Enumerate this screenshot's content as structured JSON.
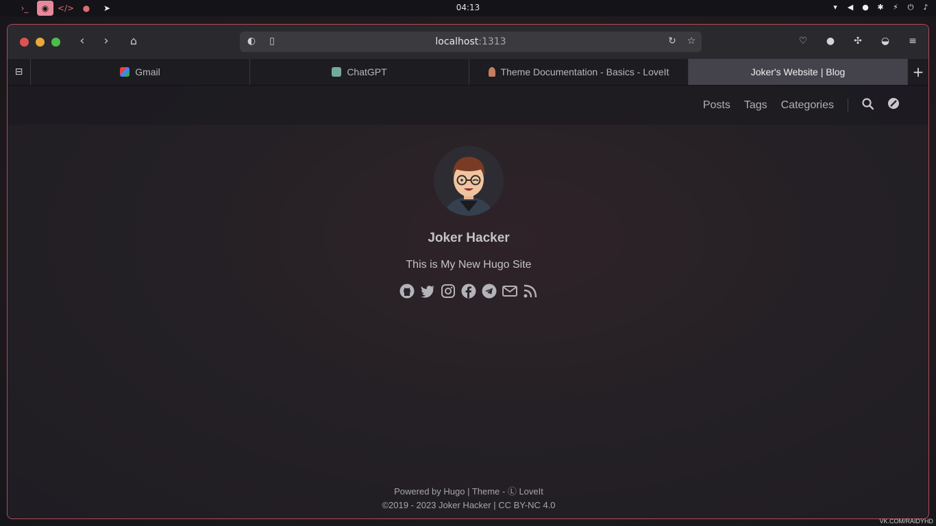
{
  "system_bar": {
    "clock": "04:13",
    "apps": [
      {
        "name": "terminal-icon",
        "glyph": "›_"
      },
      {
        "name": "browser-icon",
        "glyph": "◉"
      },
      {
        "name": "code-icon",
        "glyph": "</>"
      },
      {
        "name": "chat-icon",
        "glyph": "●"
      },
      {
        "name": "telegram-icon",
        "glyph": "➤"
      }
    ]
  },
  "browser": {
    "url_host": "localhost",
    "url_port": ":1313",
    "tabs": [
      {
        "label": "Gmail",
        "favicon": "gmail"
      },
      {
        "label": "ChatGPT",
        "favicon": "chatgpt"
      },
      {
        "label": "Theme Documentation - Basics - LoveIt",
        "favicon": "joker"
      },
      {
        "label": "Joker's Website | Blog",
        "favicon": "none"
      }
    ],
    "add_tab_label": "+"
  },
  "site": {
    "menu": {
      "posts": "Posts",
      "tags": "Tags",
      "categories": "Categories"
    },
    "profile": {
      "name": "Joker Hacker",
      "subtitle": "This is My New Hugo Site"
    },
    "social_icons": [
      "github-icon",
      "twitter-icon",
      "instagram-icon",
      "facebook-icon",
      "telegram-icon",
      "email-icon",
      "rss-icon"
    ],
    "footer": {
      "line1": "Powered by Hugo | Theme - Ⓛ LoveIt",
      "line2": "©2019 - 2023 Joker Hacker | CC BY-NC 4.0"
    }
  },
  "watermark": "VK.COM/RAIDYHD",
  "colors": {
    "accent_red": "#e0524f",
    "accent_pink": "#e8899b",
    "active_tab": "#44434b",
    "window_border": "#b14d54"
  }
}
